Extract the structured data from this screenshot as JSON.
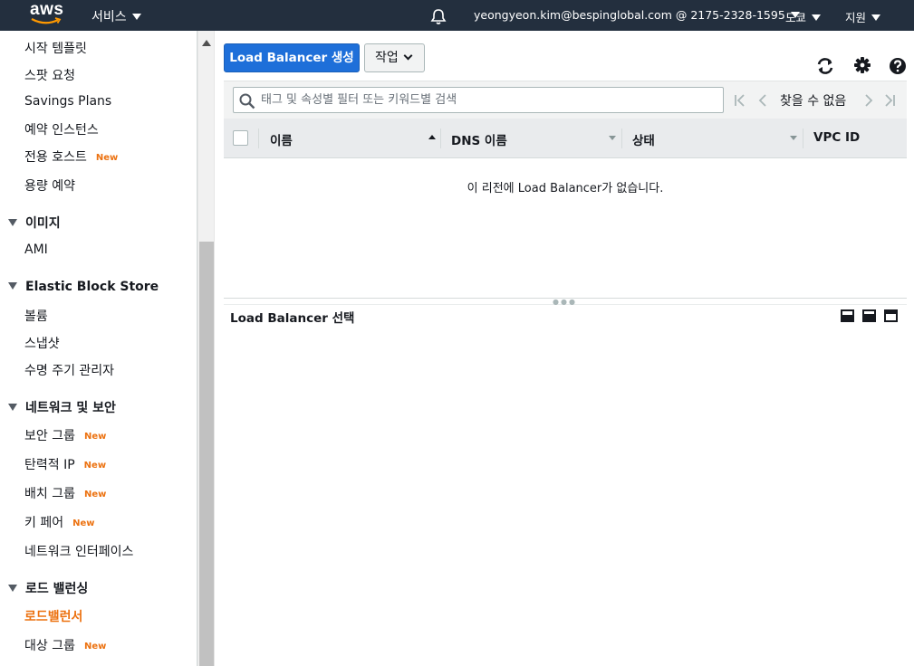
{
  "topnav": {
    "logo": "aws",
    "services_label": "서비스",
    "account_label": "yeongyeon.kim@bespinglobal.com @ 2175-2328-1595",
    "region_label": "도쿄",
    "support_label": "지원"
  },
  "sidebar": {
    "items": [
      {
        "label": "시작 템플릿"
      },
      {
        "label": "스팟 요청"
      },
      {
        "label": "Savings Plans"
      },
      {
        "label": "예약 인스턴스"
      },
      {
        "label": "전용 호스트",
        "badge": "New"
      },
      {
        "label": "용량 예약"
      }
    ],
    "sections": [
      {
        "title": "이미지",
        "items": [
          {
            "label": "AMI"
          }
        ]
      },
      {
        "title": "Elastic Block Store",
        "items": [
          {
            "label": "볼륨"
          },
          {
            "label": "스냅샷"
          },
          {
            "label": "수명 주기 관리자"
          }
        ]
      },
      {
        "title": "네트워크 및 보안",
        "items": [
          {
            "label": "보안 그룹",
            "badge": "New"
          },
          {
            "label": "탄력적 IP",
            "badge": "New"
          },
          {
            "label": "배치 그룹",
            "badge": "New"
          },
          {
            "label": "키 페어",
            "badge": "New"
          },
          {
            "label": "네트워크 인터페이스"
          }
        ]
      },
      {
        "title": "로드 밸런싱",
        "items": [
          {
            "label": "로드밸런서",
            "active": true
          },
          {
            "label": "대상 그룹",
            "badge": "New"
          }
        ]
      }
    ]
  },
  "toolbar": {
    "create_label": "Load Balancer 생성",
    "actions_label": "작업"
  },
  "filter": {
    "placeholder": "태그 및 속성별 필터 또는 키워드별 검색",
    "pager_text": "찾을 수 없음"
  },
  "table": {
    "columns": [
      "이름",
      "DNS 이름",
      "상태",
      "VPC ID"
    ],
    "empty_message": "이 리전에 Load Balancer가 없습니다."
  },
  "details": {
    "title": "Load Balancer 선택"
  },
  "colors": {
    "nav_bg": "#232f3e",
    "primary": "#1e6fd9",
    "accent": "#ec7211"
  }
}
